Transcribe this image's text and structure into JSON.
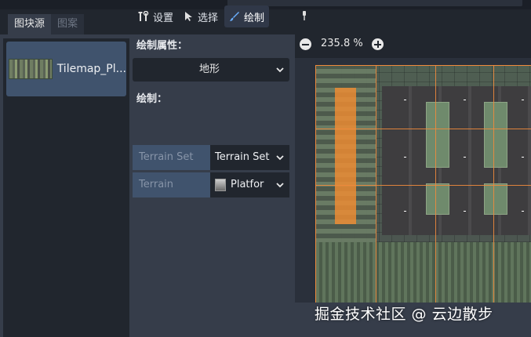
{
  "tabs": [
    {
      "label": "图块源"
    },
    {
      "label": "图案"
    }
  ],
  "source_list": {
    "items": [
      {
        "label": "Tilemap_Pl..."
      }
    ]
  },
  "toolbar": {
    "setup_label": "设置",
    "select_label": "选择",
    "paint_label": "绘制"
  },
  "paint_properties": {
    "title": "绘制属性：",
    "mode_value": "地形"
  },
  "paint": {
    "title": "绘制：",
    "terrain_set_label": "Terrain Set",
    "terrain_set_value": "Terrain Set",
    "terrain_label": "Terrain",
    "terrain_value": "Platfor"
  },
  "viewport": {
    "zoom": "235.8 %"
  },
  "watermark": "掘金技术社区 @ 云边散步",
  "colors": {
    "accent": "#6ab0ff",
    "selection": "#f08a3c",
    "panel": "#363d4a",
    "field": "#21262e",
    "highlight": "#40536d"
  }
}
